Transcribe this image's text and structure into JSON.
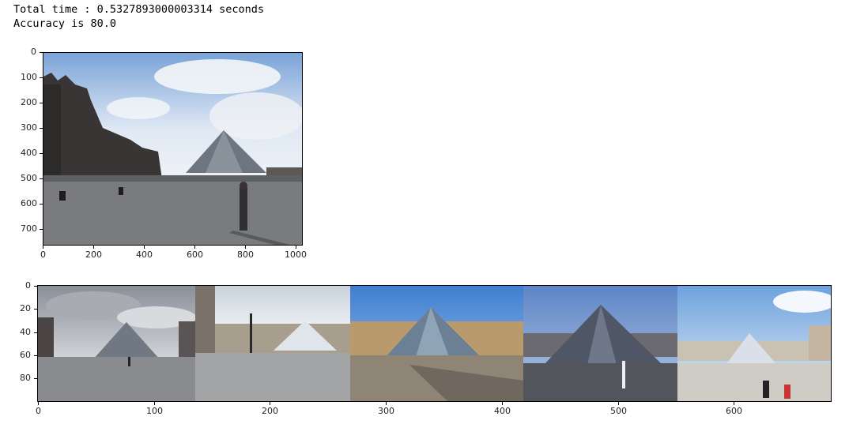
{
  "output": {
    "line1": "Total time : 0.5327893000003314 seconds",
    "line2": "Accuracy is 80.0"
  },
  "query_plot": {
    "xticks": [
      "0",
      "200",
      "400",
      "600",
      "800",
      "1000"
    ],
    "yticks": [
      "0",
      "100",
      "200",
      "300",
      "400",
      "500",
      "600",
      "700"
    ]
  },
  "results_plot": {
    "xticks": [
      "0",
      "100",
      "200",
      "300",
      "400",
      "500",
      "600"
    ],
    "yticks": [
      "0",
      "20",
      "40",
      "60",
      "80"
    ]
  },
  "images": {
    "query": "louvre-pyramid-query-photo",
    "results": [
      "louvre-match-1",
      "louvre-match-2",
      "louvre-match-3",
      "louvre-match-4",
      "louvre-match-5"
    ]
  }
}
